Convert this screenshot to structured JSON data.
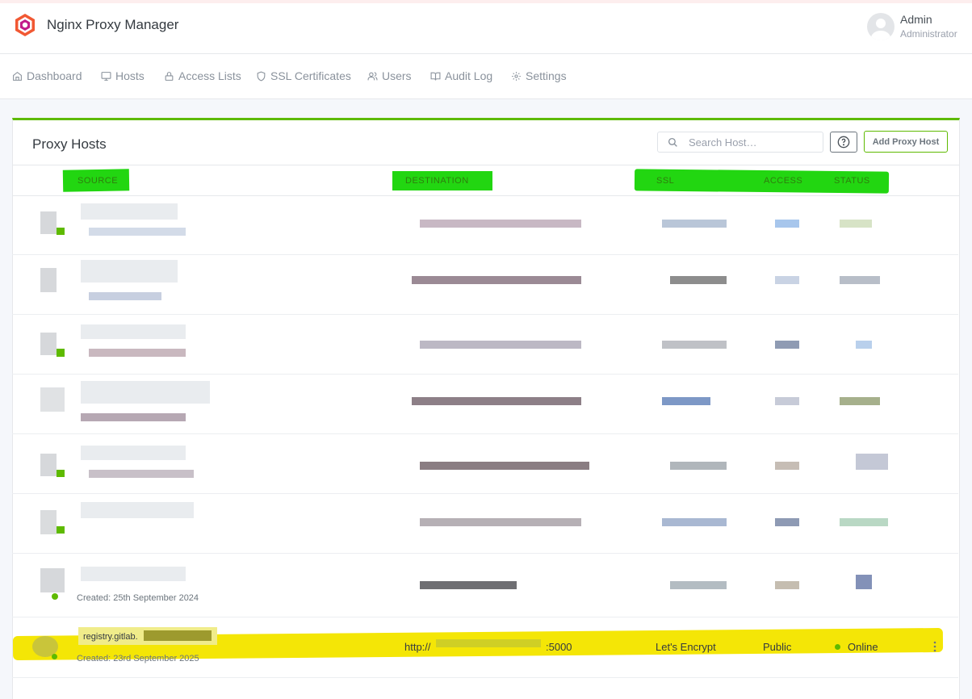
{
  "app": {
    "title": "Nginx Proxy Manager"
  },
  "user": {
    "name": "Admin",
    "role": "Administrator"
  },
  "nav": [
    {
      "label": "Dashboard",
      "icon": "home-icon"
    },
    {
      "label": "Hosts",
      "icon": "monitor-icon"
    },
    {
      "label": "Access Lists",
      "icon": "lock-icon"
    },
    {
      "label": "SSL Certificates",
      "icon": "shield-icon"
    },
    {
      "label": "Users",
      "icon": "users-icon"
    },
    {
      "label": "Audit Log",
      "icon": "book-icon"
    },
    {
      "label": "Settings",
      "icon": "gear-icon"
    }
  ],
  "card": {
    "title": "Proxy Hosts",
    "search_placeholder": "Search Host…",
    "add_label": "Add Proxy Host"
  },
  "table": {
    "headers": {
      "source": "SOURCE",
      "destination": "DESTINATION",
      "ssl": "SSL",
      "access": "ACCESS",
      "status": "STATUS"
    },
    "redacted_created": "Created: 25th September 2024",
    "last_row": {
      "source": "registry.gitlab.",
      "created": "Created: 23rd September 2025",
      "destination_prefix": "http://",
      "destination_suffix": ":5000",
      "ssl": "Let's Encrypt",
      "access": "Public",
      "status": "Online"
    }
  },
  "colors": {
    "accent": "#5eba00",
    "highlight_green": "#22d611",
    "highlight_yellow": "#f4e606"
  }
}
